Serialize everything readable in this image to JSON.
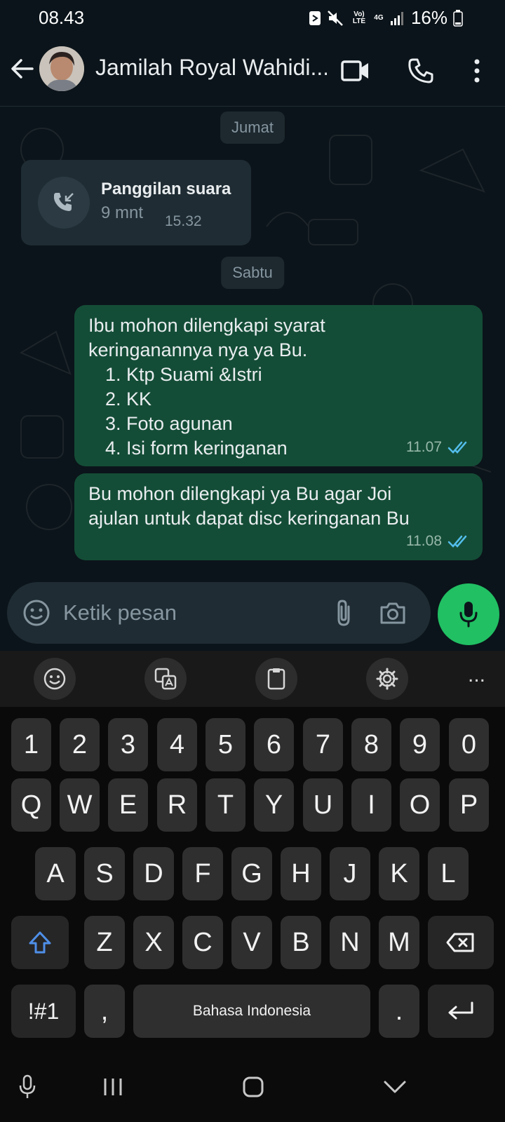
{
  "status_bar": {
    "time": "08.43",
    "network_lte": "Vo) LTE",
    "network_4g": "4G",
    "battery": "16%",
    "icons": [
      "nfc-icon",
      "mute-icon",
      "signal-icon",
      "battery-icon"
    ]
  },
  "header": {
    "contact_name": "Jamilah Royal Wahidi...",
    "icons": [
      "back-arrow-icon",
      "video-call-icon",
      "voice-call-icon",
      "more-vert-icon"
    ]
  },
  "chat": {
    "date_1": "Jumat",
    "call": {
      "title": "Panggilan suara",
      "duration": "9 mnt",
      "time": "15.32"
    },
    "date_2": "Sabtu",
    "message_1": {
      "intro": "Ibu mohon dilengkapi syarat\nkeringanannya nya ya Bu.",
      "items": [
        "1. Ktp Suami &Istri",
        "2. KK",
        "3. Foto agunan",
        "4. Isi form keringanan"
      ],
      "time": "11.07"
    },
    "message_2": {
      "text": "Bu mohon dilengkapi ya Bu agar Joi\najulan untuk dapat disc keringanan Bu",
      "time": "11.08"
    }
  },
  "composer": {
    "placeholder": "Ketik pesan"
  },
  "keyboard": {
    "number_row": [
      "1",
      "2",
      "3",
      "4",
      "5",
      "6",
      "7",
      "8",
      "9",
      "0"
    ],
    "row1": [
      "Q",
      "W",
      "E",
      "R",
      "T",
      "Y",
      "U",
      "I",
      "O",
      "P"
    ],
    "row2": [
      "A",
      "S",
      "D",
      "F",
      "G",
      "H",
      "J",
      "K",
      "L"
    ],
    "row3": [
      "Z",
      "X",
      "C",
      "V",
      "B",
      "N",
      "M"
    ],
    "symbols_key": "!#1",
    "comma_key": ",",
    "space_key": "Bahasa Indonesia",
    "period_key": ".",
    "toolbar_more": "..."
  },
  "colors": {
    "accent_green": "#21c063",
    "outgoing_bubble": "#144d37",
    "read_ticks": "#53bdeb"
  }
}
